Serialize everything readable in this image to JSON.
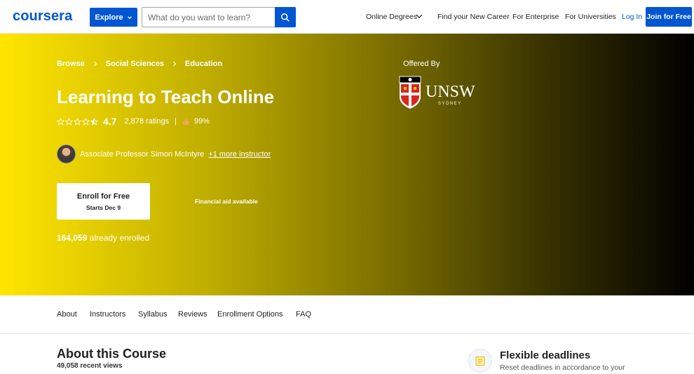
{
  "header": {
    "logo": "coursera",
    "explore_label": "Explore",
    "search_placeholder": "What do you want to learn?",
    "nav": [
      "Online Degrees",
      "Find your New Career",
      "For Enterprise",
      "For Universities"
    ],
    "login_label": "Log In",
    "join_label": "Join for Free"
  },
  "hero": {
    "breadcrumbs": [
      "Browse",
      "Social Sciences",
      "Education"
    ],
    "title": "Learning to Teach Online",
    "rating": "4.7",
    "rating_count": "2,878 ratings",
    "rating_separator": "|",
    "like_percent": "99%",
    "instructor": "Associate Professor Simon McIntyre",
    "more_instructors": "+1 more instructor",
    "enroll_label": "Enroll for Free",
    "enroll_sub": "Starts Dec 9",
    "financial_aid": "Financial aid available",
    "enrolled_count": "164,059",
    "enrolled_suffix": "already enrolled",
    "offered_by": "Offered By",
    "partner_logo_text": "UNSW",
    "partner_logo_subtext": "SYDNEY"
  },
  "tabs": [
    "About",
    "Instructors",
    "Syllabus",
    "Reviews",
    "Enrollment Options",
    "FAQ"
  ],
  "about": {
    "title": "About this Course",
    "recent_views": "49,058 recent views",
    "feature_title": "Flexible deadlines",
    "feature_desc": "Reset deadlines in accordance to your"
  },
  "icons": {
    "search": "search-icon",
    "explore_chevron": "chevron-down-icon",
    "nav_chevron": "chevron-down-icon",
    "breadcrumb_separator": "chevron-right-icon",
    "rating": "star-icon",
    "like": "thumbs-up-icon",
    "feature": "calendar-icon"
  },
  "colors": {
    "brand": "#0056d2",
    "hero_start": "#ffe600",
    "hero_end": "#000000"
  }
}
